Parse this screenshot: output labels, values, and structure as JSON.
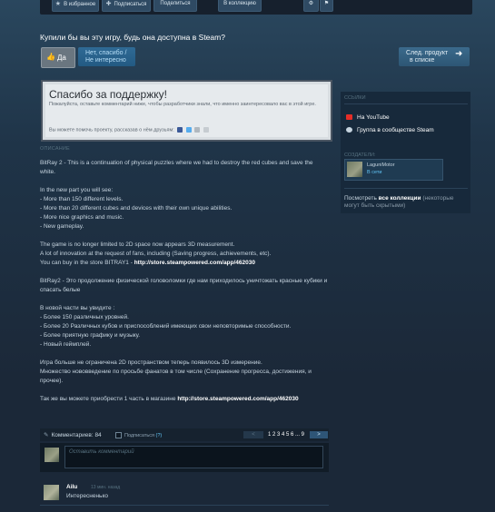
{
  "toolbar": {
    "favorites": "В избранное",
    "subscribe": "Подписаться",
    "share": "Поделиться",
    "collection": "В коллекцию"
  },
  "vote": {
    "question": "Купили бы вы эту игру, будь она доступна в Steam?",
    "yes": "Да",
    "no_line1": "Нет, спасибо /",
    "no_line2": "Не интересно",
    "next_line1": "След. продукт",
    "next_line2": "в списке"
  },
  "thanks": {
    "title": "Спасибо за поддержку!",
    "subtitle": "Пожалуйста, оставьте комментарий ниже, чтобы разработчики знали, что именно заинтересовало вас в этой игре.",
    "share_text": "Вы можете помочь проекту, рассказав о нём друзьям:"
  },
  "description": {
    "label": "ОПИСАНИЕ",
    "paragraphs": [
      "BitRay 2 - This is a continuation of physical puzzles where we had to destroy the red cubes and save the white.",
      "In the new part you will see:\n- More than 150 different levels.\n- More than 20 different cubes and devices with their own unique abilities.\n- More nice graphics and music.\n- New gameplay.",
      "The game is no longer limited to 2D space now appears 3D measurement.\nA lot of innovation at the request of fans, including (Saving progress, achievements, etc).\nYou can buy in the store BITRAY1 - ",
      "BitRay2 - Это продолжение физической головоломки где нам приходилось уничтожать красные кубики и спасать белые",
      "В новой части вы увидите :\n- Более 150 различных уровней.\n- Более 20 Различных кубов и приспособлений имеющих свои неповторимые способности.\n- Более приятную графику и музыку.\n- Новый геймплей.",
      "Игра больше не ограничена 2D пространством теперь появилось 3D измерение.\nМножество нововведение по просьбе фанатов в том числе (Сохранение прогресса, достижения, и прочее).",
      "Так же вы можете приобрести 1 часть в магазине "
    ],
    "link1": "http://store.steampowered.com/app/462030",
    "link2": "http://store.steampowered.com/app/462030"
  },
  "sidebar": {
    "links_title": "ССЫЛКИ",
    "youtube": "На YouTube",
    "community": "Группа в сообществе Steam",
    "creators_title": "СОЗДАТЕЛИ:",
    "creator_name": "LaguniMotor",
    "creator_status": "В сети",
    "collections_pre": "Посмотреть ",
    "collections_bold": "все коллекции",
    "collections_post": " (некоторые могут быть скрытыми)"
  },
  "comments": {
    "count_label": "Комментариев: 84",
    "subscribe": "Подписаться",
    "help": "(?)",
    "pages": "1 2 3 4 5 6 ... 9",
    "prev": "<",
    "next": ">",
    "placeholder": "Оставить комментарий",
    "items": [
      {
        "author": "Ailu",
        "time": "13 мин. назад",
        "text": "Интересненько"
      }
    ]
  },
  "colors": {
    "background": "#1b2838",
    "accent": "#62c4f5",
    "button_blue": "#2f6a95"
  }
}
